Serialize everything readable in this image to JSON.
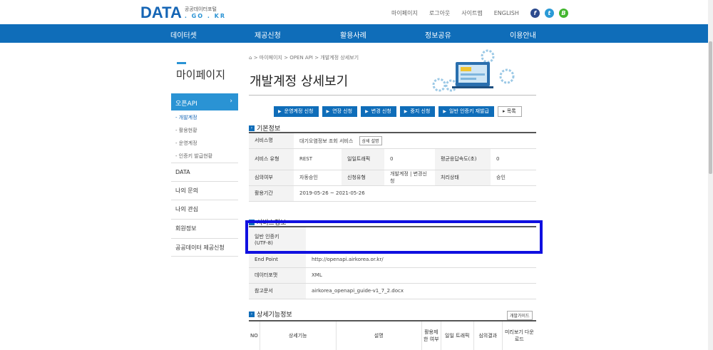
{
  "header": {
    "logo_main": "DATA",
    "logo_line1": "공공데이터포털",
    "logo_line2": ". GO . KR",
    "util_links": [
      "마이페이지",
      "로그아웃",
      "사이트맵",
      "ENGLISH"
    ],
    "sns": [
      {
        "name": "facebook",
        "glyph": "f",
        "color": "#2d4b8e"
      },
      {
        "name": "twitter",
        "glyph": "t",
        "color": "#2a9ad6"
      },
      {
        "name": "blog",
        "glyph": "B",
        "color": "#43b62f"
      }
    ]
  },
  "nav": {
    "items": [
      "데이터셋",
      "제공신청",
      "활용사례",
      "정보공유",
      "이용안내"
    ],
    "bg_color": "#0f6db9"
  },
  "sidebar": {
    "title": "마이페이지",
    "active": {
      "label": "오픈API",
      "chevron": "›"
    },
    "sub_items": [
      "- 개발계정",
      "- 활용현황",
      "- 운영계정",
      "- 인증키 발급현황"
    ],
    "menu": [
      "DATA",
      "나의 문의",
      "나의 관심",
      "회원정보",
      "공공데이터 제공신청"
    ]
  },
  "main": {
    "breadcrumb": "> 마이페이지 > OPEN API > 개발계정 상세보기",
    "title": "개발계정 상세보기",
    "buttons": [
      "운영계정 신청",
      "연장 신청",
      "변경 신청",
      "중지 신청",
      "일반 인증키 재발급"
    ],
    "list_button": "목록",
    "basic": {
      "section_title": "기본정보",
      "service_name_label": "서비스명",
      "service_name": "대기오염정보 조회 서비스",
      "detail_button": "상세 설명",
      "service_type_label": "서비스 유형",
      "service_type": "REST",
      "daily_traffic_label": "일일트래픽",
      "daily_traffic": "0",
      "avg_resp_label": "평균응답속도(초)",
      "avg_resp": "0",
      "review_label": "심의여부",
      "review": "자동승인",
      "request_type_label": "신청유형",
      "request_type": "개발계정 | 변경신청",
      "status_label": "처리상태",
      "status": "승인",
      "period_label": "활용기간",
      "period": "2019-05-26 ~ 2021-05-26"
    },
    "service": {
      "section_title": "서비스정보",
      "key_label": "일반 인증키\n(UTF-8)",
      "key_value": "",
      "endpoint_label": "End Point",
      "endpoint": "http://openapi.airkorea.or.kr/",
      "format_label": "데이터포맷",
      "format": "XML",
      "ref_label": "참고문서",
      "ref": "airkorea_openapi_guide-v1_7_2.docx"
    },
    "functions": {
      "section_title": "상세기능정보",
      "guide_button": "개발가이드",
      "columns": [
        "NO",
        "상세기능",
        "설명",
        "활용제한 여부",
        "일일 트래픽",
        "심의결과",
        "미리보기 다운로드"
      ]
    }
  },
  "highlight_color": "#1010e0"
}
